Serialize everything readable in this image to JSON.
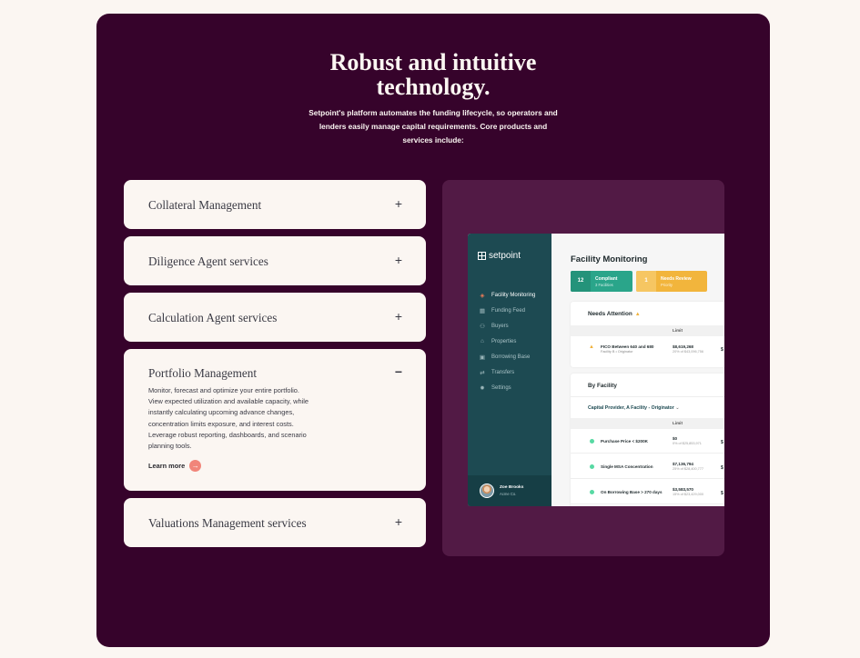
{
  "hero": {
    "title_line1": "Robust and intuitive",
    "title_line2": "technology.",
    "subtitle": "Setpoint's platform automates the funding lifecycle, so operators and lenders easily manage capital requirements. Core products and services include:"
  },
  "accordion": [
    {
      "title": "Collateral Management",
      "toggle": "+"
    },
    {
      "title": "Diligence Agent services",
      "toggle": "+"
    },
    {
      "title": "Calculation Agent services",
      "toggle": "+"
    },
    {
      "title": "Portfolio Management",
      "toggle": "−",
      "body": "Monitor, forecast and optimize your entire portfolio. View expected utilization and available capacity, while instantly calculating upcoming advance changes, concentration limits exposure, and interest costs. Leverage robust reporting, dashboards, and scenario planning tools.",
      "cta": "Learn more"
    },
    {
      "title": "Valuations Management services",
      "toggle": "+"
    }
  ],
  "app": {
    "logo": "setpoint",
    "nav": [
      {
        "label": "Facility Monitoring",
        "icon": "◈"
      },
      {
        "label": "Funding Feed",
        "icon": "▦"
      },
      {
        "label": "Buyers",
        "icon": "⚇"
      },
      {
        "label": "Properties",
        "icon": "⌂"
      },
      {
        "label": "Borrowing Base",
        "icon": "▣"
      },
      {
        "label": "Transfers",
        "icon": "⇄"
      },
      {
        "label": "Settings",
        "icon": "✹"
      }
    ],
    "user": {
      "name": "Zoe Brooks",
      "org": "Acme Co."
    },
    "title": "Facility Monitoring",
    "compliant": {
      "count": "12",
      "label": "Compliant",
      "sub": "3 Facilities"
    },
    "review": {
      "count": "1",
      "label": "Needs Review",
      "sub": "Priority"
    },
    "needs_attention": {
      "heading": "Needs Attention",
      "col": "Limit",
      "row": {
        "name": "FICO Between 640 and 680",
        "sub": "Facility B • Originator",
        "value": "$8,619,268",
        "value_sub": "20% of $43,096,756",
        "trunc": "$"
      }
    },
    "by_facility": {
      "heading": "By Facility",
      "selector": "Capital Provider, A Facility - Originator",
      "col": "Limit",
      "rows": [
        {
          "name": "Purchase Price < $200K",
          "value": "$0",
          "value_sub": "0% of $25,853,971",
          "trunc": "$"
        },
        {
          "name": "Single MSA Concentration",
          "value": "$7,136,794",
          "value_sub": "25% of $28,400,777",
          "trunc": "$"
        },
        {
          "name": "On Borrowing Base > 270 days",
          "value": "$3,583,570",
          "value_sub": "15% of $23,429,000",
          "trunc": "$"
        }
      ]
    }
  }
}
